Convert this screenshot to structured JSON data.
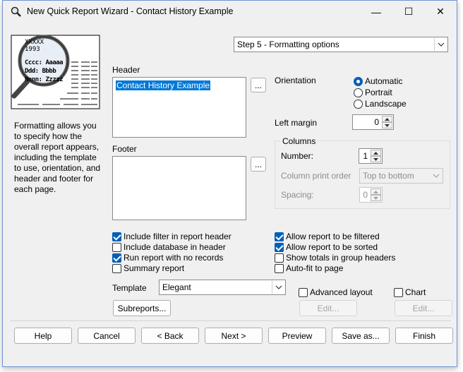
{
  "window": {
    "title": "New Quick Report Wizard - Contact History Example"
  },
  "titlebar": {
    "minimize": "—",
    "maximize": "☐",
    "close": "✕"
  },
  "preview": {
    "lines": [
      "XXXXX",
      "1993",
      "Cccc: Aaaaa",
      "Ddd: Bbbb",
      "Nnnn: Zzzzz"
    ]
  },
  "description": "Formatting allows you to specify how the overall report appears, including the template to use, orientation, and header and footer for each page.",
  "step_selector": {
    "value": "Step 5 - Formatting options"
  },
  "header": {
    "label": "Header",
    "value": "Contact History Example",
    "ellipsis": "..."
  },
  "footer": {
    "label": "Footer",
    "value": "",
    "ellipsis": "..."
  },
  "orientation": {
    "label": "Orientation",
    "options": [
      "Automatic",
      "Portrait",
      "Landscape"
    ],
    "selected": "Automatic"
  },
  "left_margin": {
    "label": "Left margin",
    "value": "0"
  },
  "columns": {
    "label": "Columns",
    "number_label": "Number:",
    "number_value": "1",
    "print_order_label": "Column print order",
    "print_order_value": "Top to bottom",
    "spacing_label": "Spacing:",
    "spacing_value": "0"
  },
  "checkboxes_left": [
    {
      "label": "Include filter in report header",
      "checked": true
    },
    {
      "label": "Include database in header",
      "checked": false
    },
    {
      "label": "Run report with no records",
      "checked": true
    },
    {
      "label": "Summary report",
      "checked": false
    }
  ],
  "checkboxes_right": [
    {
      "label": "Allow report to be filtered",
      "checked": true
    },
    {
      "label": "Allow report to be sorted",
      "checked": true
    },
    {
      "label": "Show totals in group headers",
      "checked": false
    },
    {
      "label": "Auto-fit to page",
      "checked": false
    }
  ],
  "template": {
    "label": "Template",
    "value": "Elegant"
  },
  "advanced_layout": {
    "label": "Advanced layout",
    "checked": false,
    "edit": "Edit..."
  },
  "chart": {
    "label": "Chart",
    "checked": false,
    "edit": "Edit..."
  },
  "subreports_button": "Subreports...",
  "footer_buttons": {
    "help": "Help",
    "cancel": "Cancel",
    "back": "< Back",
    "next": "Next >",
    "preview": "Preview",
    "save_as": "Save as...",
    "finish": "Finish"
  },
  "colors": {
    "accent": "#005fb8",
    "selection": "#0078d7",
    "window_bg": "#f0f0f0"
  }
}
